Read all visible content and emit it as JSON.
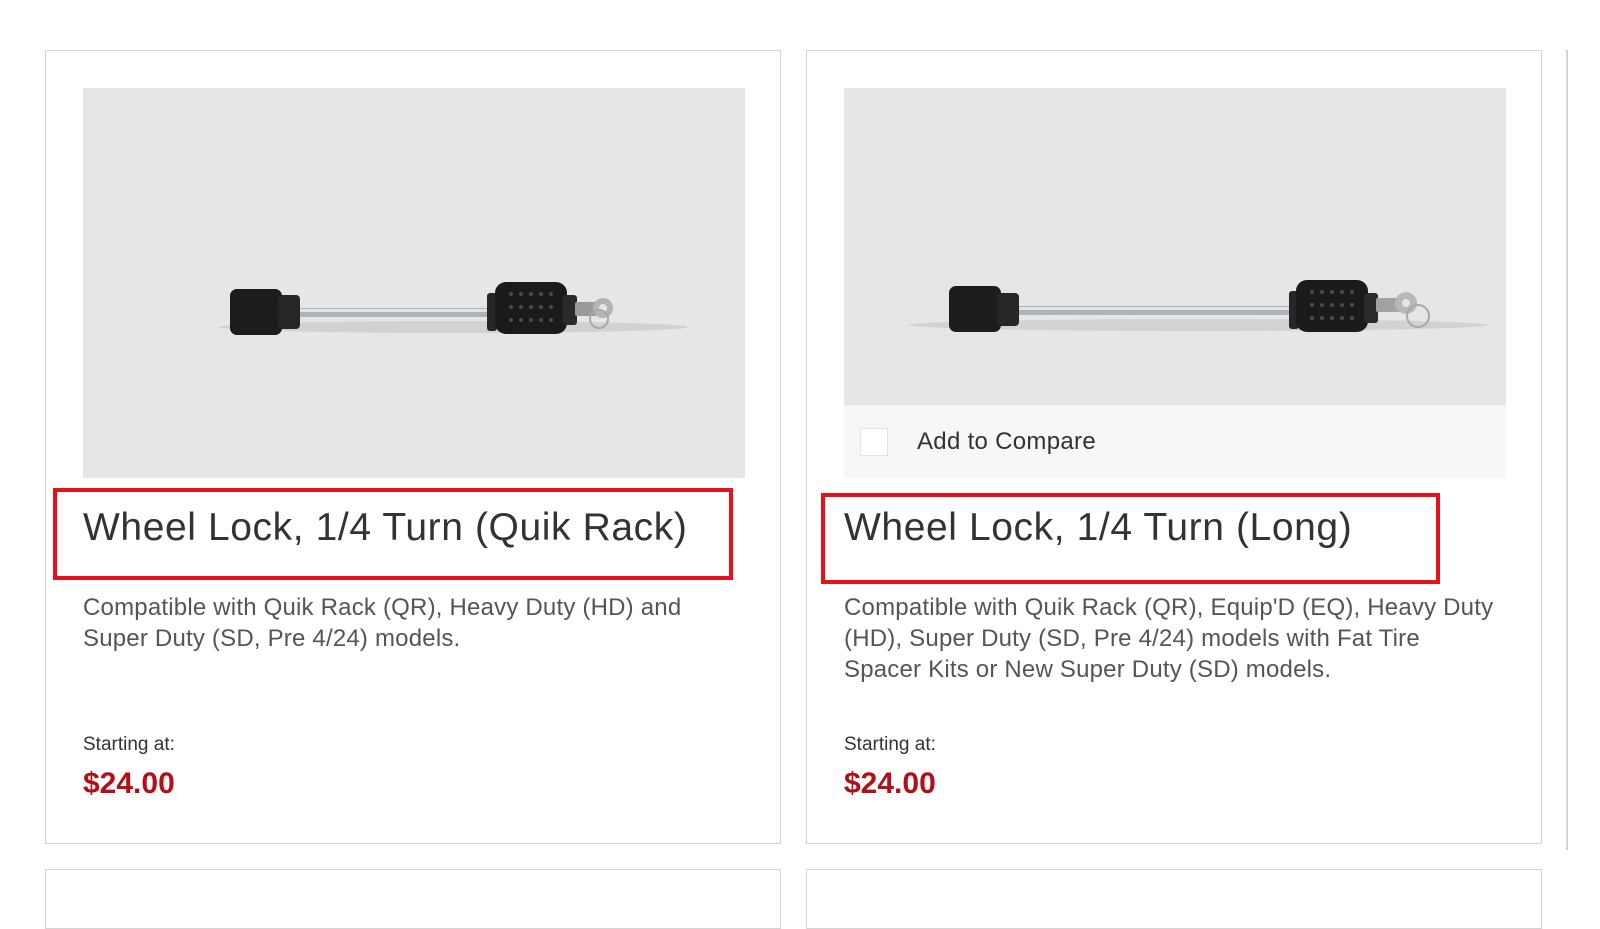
{
  "products": [
    {
      "title": "Wheel Lock, 1/4 Turn (Quik Rack)",
      "description": "Compatible with Quik Rack (QR), Heavy Duty (HD) and Super Duty (SD, Pre 4/24) models.",
      "price_label": "Starting at:",
      "price": "$24.00",
      "image_icon": "wheel-lock-image"
    },
    {
      "title": "Wheel Lock, 1/4 Turn (Long)",
      "description": "Compatible with Quik Rack (QR), Equip'D (EQ), Heavy Duty (HD), Super Duty (SD, Pre 4/24) models with Fat Tire Spacer Kits or New Super Duty (SD) models.",
      "price_label": "Starting at:",
      "price": "$24.00",
      "compare_label": "Add to Compare",
      "image_icon": "wheel-lock-image"
    }
  ],
  "colors": {
    "price": "#b30f17",
    "highlight": "#e8101b",
    "image_background": "#e6e6e6"
  }
}
